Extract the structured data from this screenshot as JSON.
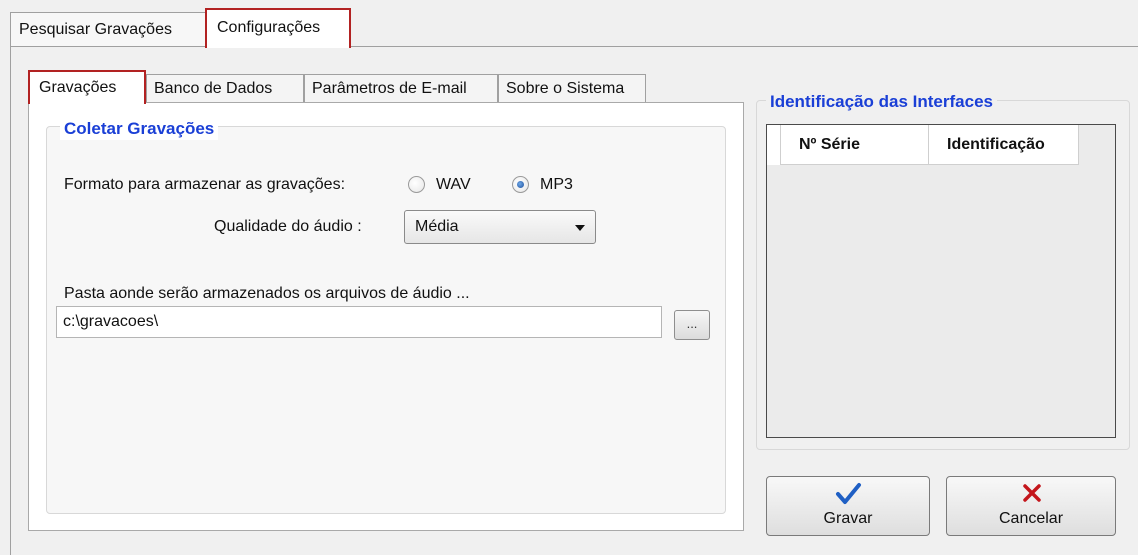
{
  "top_tabs": [
    {
      "label": "Pesquisar Gravações",
      "active": false
    },
    {
      "label": "Configurações",
      "active": true
    }
  ],
  "inner_tabs": [
    {
      "label": "Gravações",
      "active": true
    },
    {
      "label": "Banco de Dados",
      "active": false
    },
    {
      "label": "Parâmetros de E-mail",
      "active": false
    },
    {
      "label": "Sobre o Sistema",
      "active": false
    }
  ],
  "coletar": {
    "title": "Coletar Gravações",
    "format_label": "Formato para armazenar as gravações:",
    "format_options": [
      {
        "label": "WAV",
        "checked": false
      },
      {
        "label": "MP3",
        "checked": true
      }
    ],
    "quality_label": "Qualidade do áudio :",
    "quality_value": "Média",
    "folder_label": "Pasta aonde serão armazenados os arquivos de áudio ...",
    "folder_value": "c:\\gravacoes\\",
    "browse_label": "..."
  },
  "interfaces": {
    "title": "Identificação das Interfaces",
    "columns": [
      "Nº Série",
      "Identificação"
    ]
  },
  "buttons": {
    "save_label": "Gravar",
    "save_icon": "check-icon",
    "cancel_label": "Cancelar",
    "cancel_icon": "x-icon"
  },
  "colors": {
    "title_blue": "#1a3fd6",
    "active_tab_border": "#b22222",
    "check_blue": "#1f5fc4",
    "cancel_red": "#c4161c"
  }
}
